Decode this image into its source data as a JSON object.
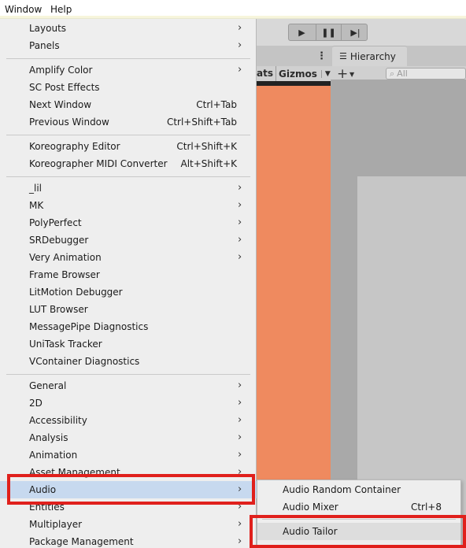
{
  "menubar": {
    "window": "Window",
    "help": "Help"
  },
  "toolbar": {
    "play_icon": "play-icon",
    "pause_icon": "pause-icon",
    "step_icon": "step-icon",
    "dots": "⋮"
  },
  "hierarchy": {
    "tab_label": "Hierarchy",
    "search_placeholder": "All"
  },
  "scene": {
    "stats_label": "ats",
    "gizmos_label": "Gizmos"
  },
  "colors": {
    "scene_view": "#ef8a5f",
    "highlight_box": "#e0201c",
    "menu_bg": "#eeeeee"
  },
  "menu": {
    "group1": [
      {
        "label": "Layouts",
        "submenu": true
      },
      {
        "label": "Panels",
        "submenu": true
      }
    ],
    "group2": [
      {
        "label": "Amplify Color",
        "submenu": true
      },
      {
        "label": "SC Post Effects"
      },
      {
        "label": "Next Window",
        "shortcut": "Ctrl+Tab"
      },
      {
        "label": "Previous Window",
        "shortcut": "Ctrl+Shift+Tab"
      }
    ],
    "group3": [
      {
        "label": "Koreography Editor",
        "shortcut": "Ctrl+Shift+K"
      },
      {
        "label": "Koreographer MIDI Converter",
        "shortcut": "Alt+Shift+K"
      }
    ],
    "group4": [
      {
        "label": "_lil",
        "submenu": true
      },
      {
        "label": "MK",
        "submenu": true
      },
      {
        "label": "PolyPerfect",
        "submenu": true
      },
      {
        "label": "SRDebugger",
        "submenu": true
      },
      {
        "label": "Very Animation",
        "submenu": true
      },
      {
        "label": "Frame Browser"
      },
      {
        "label": "LitMotion Debugger"
      },
      {
        "label": "LUT Browser"
      },
      {
        "label": "MessagePipe Diagnostics"
      },
      {
        "label": "UniTask Tracker"
      },
      {
        "label": "VContainer Diagnostics"
      }
    ],
    "group5": [
      {
        "label": "General",
        "submenu": true
      },
      {
        "label": "2D",
        "submenu": true
      },
      {
        "label": "Accessibility",
        "submenu": true
      },
      {
        "label": "Analysis",
        "submenu": true
      },
      {
        "label": "Animation",
        "submenu": true
      },
      {
        "label": "Asset Management",
        "submenu": true
      },
      {
        "label": "Audio",
        "submenu": true,
        "highlighted": true
      },
      {
        "label": "Entities",
        "submenu": true
      },
      {
        "label": "Multiplayer",
        "submenu": true
      },
      {
        "label": "Package Management",
        "submenu": true
      }
    ]
  },
  "audio_submenu": {
    "items": [
      {
        "label": "Audio Random Container"
      },
      {
        "label": "Audio Mixer",
        "shortcut": "Ctrl+8"
      },
      {
        "label": "Audio Tailor",
        "highlighted": true
      }
    ]
  }
}
